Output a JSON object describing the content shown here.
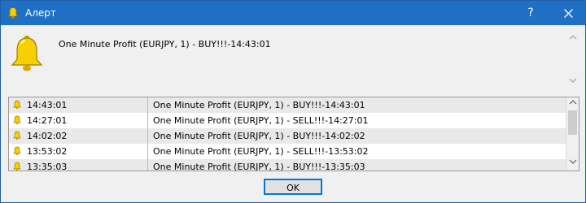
{
  "window": {
    "title": "Алерт",
    "help_label": "?",
    "close_icon": "close-icon"
  },
  "message": {
    "text": "One Minute Profit (EURJPY, 1)  - BUY!!!-14:43:01",
    "icon": "bell-icon"
  },
  "alerts": [
    {
      "time": "14:43:01",
      "message": "One Minute Profit (EURJPY, 1)  - BUY!!!-14:43:01"
    },
    {
      "time": "14:27:01",
      "message": "One Minute Profit (EURJPY, 1)  - SELL!!!-14:27:01"
    },
    {
      "time": "14:02:02",
      "message": "One Minute Profit (EURJPY, 1)  - BUY!!!-14:02:02"
    },
    {
      "time": "13:53:02",
      "message": "One Minute Profit (EURJPY, 1)  - SELL!!!-13:53:02"
    },
    {
      "time": "13:35:03",
      "message": "One Minute Profit (EURJPY, 1)  - BUY!!!-13:35:03"
    }
  ],
  "buttons": {
    "ok_label": "OK"
  },
  "colors": {
    "titlebar": "#1f6fc4",
    "bell": "#f2c300"
  }
}
